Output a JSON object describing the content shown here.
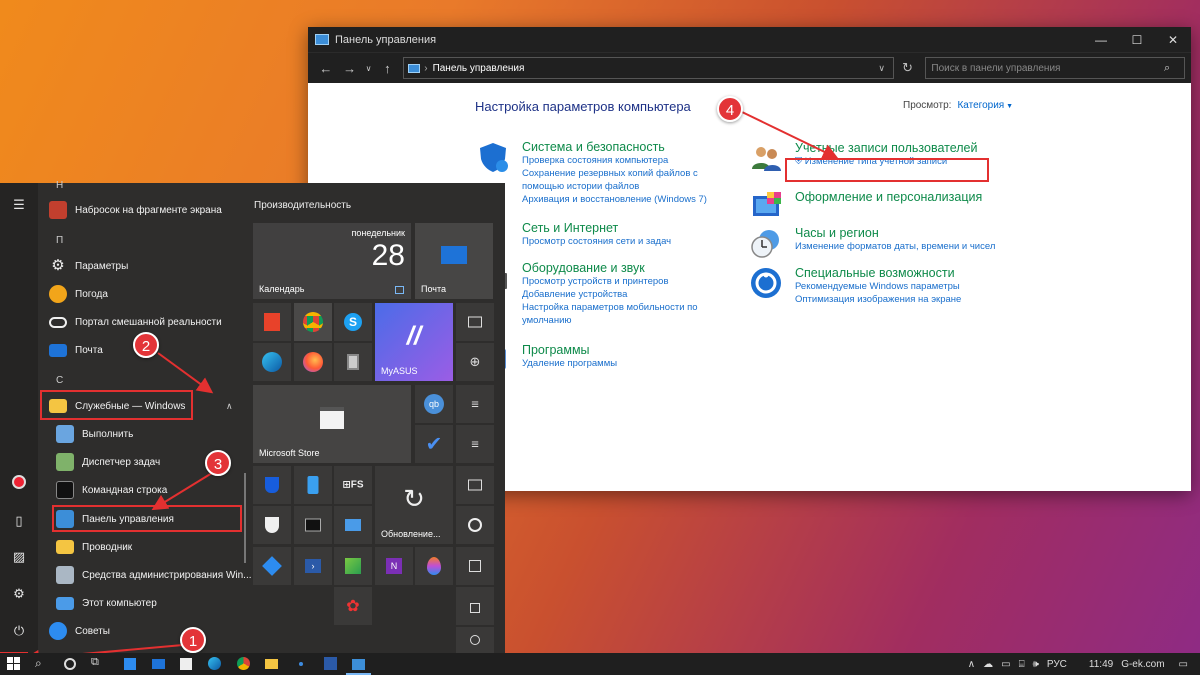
{
  "control_panel": {
    "window_title": "Панель управления",
    "window_buttons": [
      "—",
      "☐",
      "✕"
    ],
    "address": "Панель управления",
    "search_placeholder": "Поиск в панели управления",
    "heading": "Настройка параметров компьютера",
    "view_by_label": "Просмотр:",
    "view_by_value": "Категория",
    "categories": [
      {
        "title": "Система и безопасность",
        "links": [
          "Проверка состояния компьютера",
          "Сохранение резервных копий файлов с",
          "помощью истории файлов",
          "Архивация и восстановление (Windows 7)"
        ]
      },
      {
        "title": "Сеть и Интернет",
        "links": [
          "Просмотр состояния сети и задач"
        ]
      },
      {
        "title": "Оборудование и звук",
        "links": [
          "Просмотр устройств и принтеров",
          "Добавление устройства",
          "Настройка параметров мобильности по",
          "умолчанию"
        ]
      },
      {
        "title": "Программы",
        "links": [
          "Удаление программы"
        ]
      },
      {
        "title": "Учетные записи пользователей",
        "links": [
          "Изменение типа учетной записи"
        ]
      },
      {
        "title": "Оформление и персонализация",
        "links": []
      },
      {
        "title": "Часы и регион",
        "links": [
          "Изменение форматов даты, времени и чисел"
        ]
      },
      {
        "title": "Специальные возможности",
        "links": [
          "Рекомендуемые Windows параметры",
          "Оптимизация изображения на экране"
        ]
      }
    ]
  },
  "start_menu": {
    "letters": [
      "Н",
      "П",
      "С"
    ],
    "apps": [
      {
        "label": "Набросок на фрагменте экрана",
        "icon": "snip-sketch-icon",
        "color": "#c23f2e"
      },
      {
        "label": "Параметры",
        "icon": "gear-icon",
        "color": "#5a5a5a"
      },
      {
        "label": "Погода",
        "icon": "weather-icon",
        "color": "#f2a51a"
      },
      {
        "label": "Портал смешанной реальности",
        "icon": "mixed-reality-icon",
        "color": "#f0f0f0"
      },
      {
        "label": "Почта",
        "icon": "mail-icon",
        "color": "#1e73d8"
      },
      {
        "label": "Служебные — Windows",
        "icon": "folder-icon",
        "color": "#f4c542"
      },
      {
        "label": "Выполнить",
        "icon": "run-icon",
        "color": "#6aa5e0"
      },
      {
        "label": "Диспетчер задач",
        "icon": "task-manager-icon",
        "color": "#7fb26a"
      },
      {
        "label": "Командная строка",
        "icon": "cmd-icon",
        "color": "#111111"
      },
      {
        "label": "Панель управления",
        "icon": "control-panel-icon",
        "color": "#3c8ed8"
      },
      {
        "label": "Проводник",
        "icon": "explorer-icon",
        "color": "#f4c542"
      },
      {
        "label": "Средства администрирования Win...",
        "icon": "admin-tools-icon",
        "color": "#aab7c4"
      },
      {
        "label": "Этот компьютер",
        "icon": "this-pc-icon",
        "color": "#4b9be8"
      },
      {
        "label": "Советы",
        "icon": "tips-icon",
        "color": "#2d8cf0"
      }
    ],
    "group_title": "Производительность",
    "calendar": {
      "day": "понедельник",
      "date": "28",
      "label": "Календарь"
    },
    "mail_tile_label": "Почта",
    "myasus_label": "MyASUS",
    "store_label": "Microsoft Store",
    "update_label": "Обновление..."
  },
  "badges": [
    "1",
    "2",
    "3",
    "4"
  ],
  "taskbar": {
    "language": "РУС",
    "time": "11:49",
    "site": "G-ek.com"
  }
}
